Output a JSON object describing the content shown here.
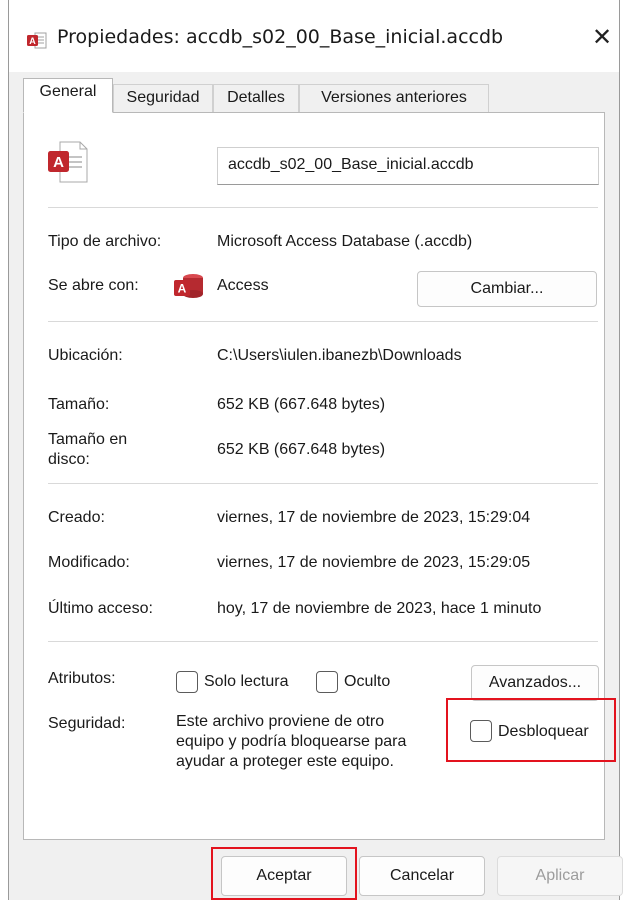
{
  "window": {
    "title": "Propiedades: accdb_s02_00_Base_inicial.accdb",
    "close_symbol": "✕"
  },
  "tabs": [
    {
      "label": "General",
      "active": true
    },
    {
      "label": "Seguridad",
      "active": false
    },
    {
      "label": "Detalles",
      "active": false
    },
    {
      "label": "Versiones anteriores",
      "active": false
    }
  ],
  "general": {
    "file_icon": "access-file-icon",
    "file_name": "accdb_s02_00_Base_inicial.accdb",
    "type_label": "Tipo de archivo:",
    "type_value": "Microsoft Access Database (.accdb)",
    "opens_with_label": "Se abre con:",
    "opens_with_app_icon": "access-app-icon",
    "opens_with_value": "Access",
    "change_button": "Cambiar...",
    "location_label": "Ubicación:",
    "location_value": "C:\\Users\\iulen.ibanezb\\Downloads",
    "size_label": "Tamaño:",
    "size_value": "652 KB (667.648 bytes)",
    "disk_size_label_line1": "Tamaño en",
    "disk_size_label_line2": "disco:",
    "disk_size_value": "652 KB (667.648 bytes)",
    "created_label": "Creado:",
    "created_value": "viernes, 17 de noviembre de 2023, 15:29:04",
    "modified_label": "Modificado:",
    "modified_value": "viernes, 17 de noviembre de 2023, 15:29:05",
    "accessed_label": "Último acceso:",
    "accessed_value": "hoy, 17 de noviembre de 2023, hace 1 minuto",
    "attributes_label": "Atributos:",
    "readonly_label": "Solo lectura",
    "readonly_checked": false,
    "hidden_label": "Oculto",
    "hidden_checked": false,
    "advanced_button": "Avanzados...",
    "security_label": "Seguridad:",
    "security_text_line1": "Este archivo proviene de otro",
    "security_text_line2": "equipo y podría bloquearse para",
    "security_text_line3": "ayudar a proteger este equipo.",
    "unblock_label": "Desbloquear",
    "unblock_checked": false
  },
  "footer": {
    "ok_button": "Aceptar",
    "cancel_button": "Cancelar",
    "apply_button": "Aplicar",
    "apply_disabled": true
  },
  "colors": {
    "highlight": "#e3131e",
    "access_brand": "#c0272d"
  }
}
